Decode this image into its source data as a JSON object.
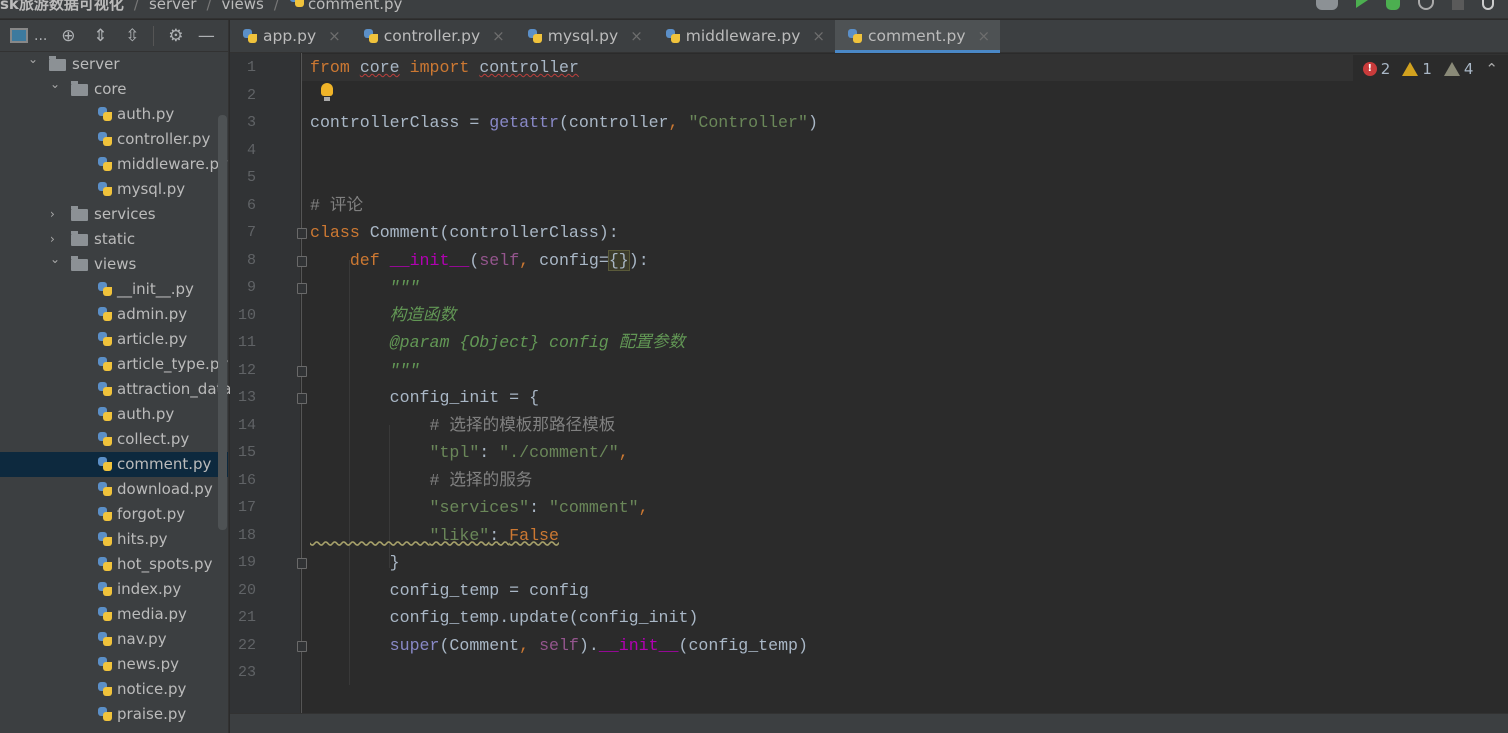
{
  "breadcrumb": {
    "project": "sk旅游数据可视化",
    "items": [
      "server",
      "views"
    ],
    "file": "comment.py"
  },
  "toolbar": {
    "icons": [
      "user-icon",
      "run-icon",
      "debug-icon",
      "coverage-icon",
      "stop-icon",
      "search-icon"
    ],
    "colors": {
      "run": "#4caf50"
    }
  },
  "sidebar": {
    "tools": [
      "project-view-icon",
      "more",
      "locate-icon",
      "expand-all-icon",
      "collapse-all-icon",
      "gear-icon",
      "hide-icon"
    ],
    "more_label": "...",
    "tree": [
      {
        "label": "server",
        "type": "folder",
        "open": true,
        "depth": 0
      },
      {
        "label": "core",
        "type": "folder",
        "open": true,
        "depth": 1
      },
      {
        "label": "auth.py",
        "type": "file",
        "depth": 2
      },
      {
        "label": "controller.py",
        "type": "file",
        "depth": 2
      },
      {
        "label": "middleware.py",
        "type": "file",
        "depth": 2
      },
      {
        "label": "mysql.py",
        "type": "file",
        "depth": 2
      },
      {
        "label": "services",
        "type": "folder",
        "open": false,
        "depth": 1
      },
      {
        "label": "static",
        "type": "folder",
        "open": false,
        "depth": 1
      },
      {
        "label": "views",
        "type": "folder",
        "open": true,
        "depth": 1
      },
      {
        "label": "__init__.py",
        "type": "file",
        "depth": 2
      },
      {
        "label": "admin.py",
        "type": "file",
        "depth": 2
      },
      {
        "label": "article.py",
        "type": "file",
        "depth": 2
      },
      {
        "label": "article_type.py",
        "type": "file",
        "depth": 2
      },
      {
        "label": "attraction_data.",
        "type": "file",
        "depth": 2
      },
      {
        "label": "auth.py",
        "type": "file",
        "depth": 2
      },
      {
        "label": "collect.py",
        "type": "file",
        "depth": 2
      },
      {
        "label": "comment.py",
        "type": "file",
        "depth": 2,
        "selected": true
      },
      {
        "label": "download.py",
        "type": "file",
        "depth": 2
      },
      {
        "label": "forgot.py",
        "type": "file",
        "depth": 2
      },
      {
        "label": "hits.py",
        "type": "file",
        "depth": 2
      },
      {
        "label": "hot_spots.py",
        "type": "file",
        "depth": 2
      },
      {
        "label": "index.py",
        "type": "file",
        "depth": 2
      },
      {
        "label": "media.py",
        "type": "file",
        "depth": 2
      },
      {
        "label": "nav.py",
        "type": "file",
        "depth": 2
      },
      {
        "label": "news.py",
        "type": "file",
        "depth": 2
      },
      {
        "label": "notice.py",
        "type": "file",
        "depth": 2
      },
      {
        "label": "praise.py",
        "type": "file",
        "depth": 2
      }
    ]
  },
  "tabs": [
    {
      "label": "app.py",
      "active": false
    },
    {
      "label": "controller.py",
      "active": false
    },
    {
      "label": "mysql.py",
      "active": false
    },
    {
      "label": "middleware.py",
      "active": false
    },
    {
      "label": "comment.py",
      "active": true
    }
  ],
  "close_glyph": "×",
  "inspections": {
    "errors": "2",
    "warnings": "1",
    "weak_warnings": "4"
  },
  "code": [
    [
      [
        "kw",
        "from"
      ],
      [
        "pl",
        " "
      ],
      [
        "pl",
        "core",
        "wavy"
      ],
      [
        "pl",
        " "
      ],
      [
        "kw",
        "import"
      ],
      [
        "pl",
        " "
      ],
      [
        "pl",
        "controller",
        "wavy"
      ]
    ],
    [],
    [
      [
        "pl",
        "controllerClass = "
      ],
      [
        "bi",
        "getattr"
      ],
      [
        "pl",
        "(controller"
      ],
      [
        "kw",
        ", "
      ],
      [
        "st",
        "\"Controller\""
      ],
      [
        "pl",
        ")"
      ]
    ],
    [],
    [],
    [
      [
        "cm",
        "# 评论"
      ]
    ],
    [
      [
        "kw",
        "class "
      ],
      [
        "pl",
        "Comment(controllerClass):"
      ]
    ],
    [
      [
        "pl",
        "    "
      ],
      [
        "kw",
        "def "
      ],
      [
        "mg",
        "__init__"
      ],
      [
        "pl",
        "("
      ],
      [
        "sf",
        "self"
      ],
      [
        "kw",
        ", "
      ],
      [
        "pl",
        "config="
      ],
      [
        "pl",
        "{}",
        "brace"
      ],
      [
        "pl",
        "):"
      ]
    ],
    [
      [
        "pl",
        "        "
      ],
      [
        "dc",
        "\"\"\""
      ]
    ],
    [
      [
        "pl",
        "        "
      ],
      [
        "dc",
        "构造函数"
      ]
    ],
    [
      [
        "pl",
        "        "
      ],
      [
        "dc",
        "@param {Object} config 配置参数"
      ]
    ],
    [
      [
        "pl",
        "        "
      ],
      [
        "dc",
        "\"\"\""
      ]
    ],
    [
      [
        "pl",
        "        config_init = {"
      ]
    ],
    [
      [
        "pl",
        "            "
      ],
      [
        "cm",
        "# 选择的模板那路径模板"
      ]
    ],
    [
      [
        "pl",
        "            "
      ],
      [
        "st",
        "\"tpl\""
      ],
      [
        "pl",
        ": "
      ],
      [
        "st",
        "\"./comment/\""
      ],
      [
        "kw",
        ","
      ]
    ],
    [
      [
        "pl",
        "            "
      ],
      [
        "cm",
        "# 选择的服务"
      ]
    ],
    [
      [
        "pl",
        "            "
      ],
      [
        "st",
        "\"services\""
      ],
      [
        "pl",
        ": "
      ],
      [
        "st",
        "\"comment\""
      ],
      [
        "kw",
        ","
      ]
    ],
    [
      [
        "pl",
        "            "
      ],
      [
        "st",
        "\"like\""
      ],
      [
        "pl",
        ": "
      ],
      [
        "kw",
        "False"
      ]
    ],
    [
      [
        "pl",
        "        }"
      ]
    ],
    [
      [
        "pl",
        "        config_temp = config"
      ]
    ],
    [
      [
        "pl",
        "        config_temp.update(config_init)"
      ]
    ],
    [
      [
        "pl",
        "        "
      ],
      [
        "bi",
        "super"
      ],
      [
        "pl",
        "(Comment"
      ],
      [
        "kw",
        ", "
      ],
      [
        "sf",
        "self"
      ],
      [
        "pl",
        ")."
      ],
      [
        "mg",
        "__init__"
      ],
      [
        "pl",
        "(config_temp)"
      ]
    ],
    []
  ]
}
